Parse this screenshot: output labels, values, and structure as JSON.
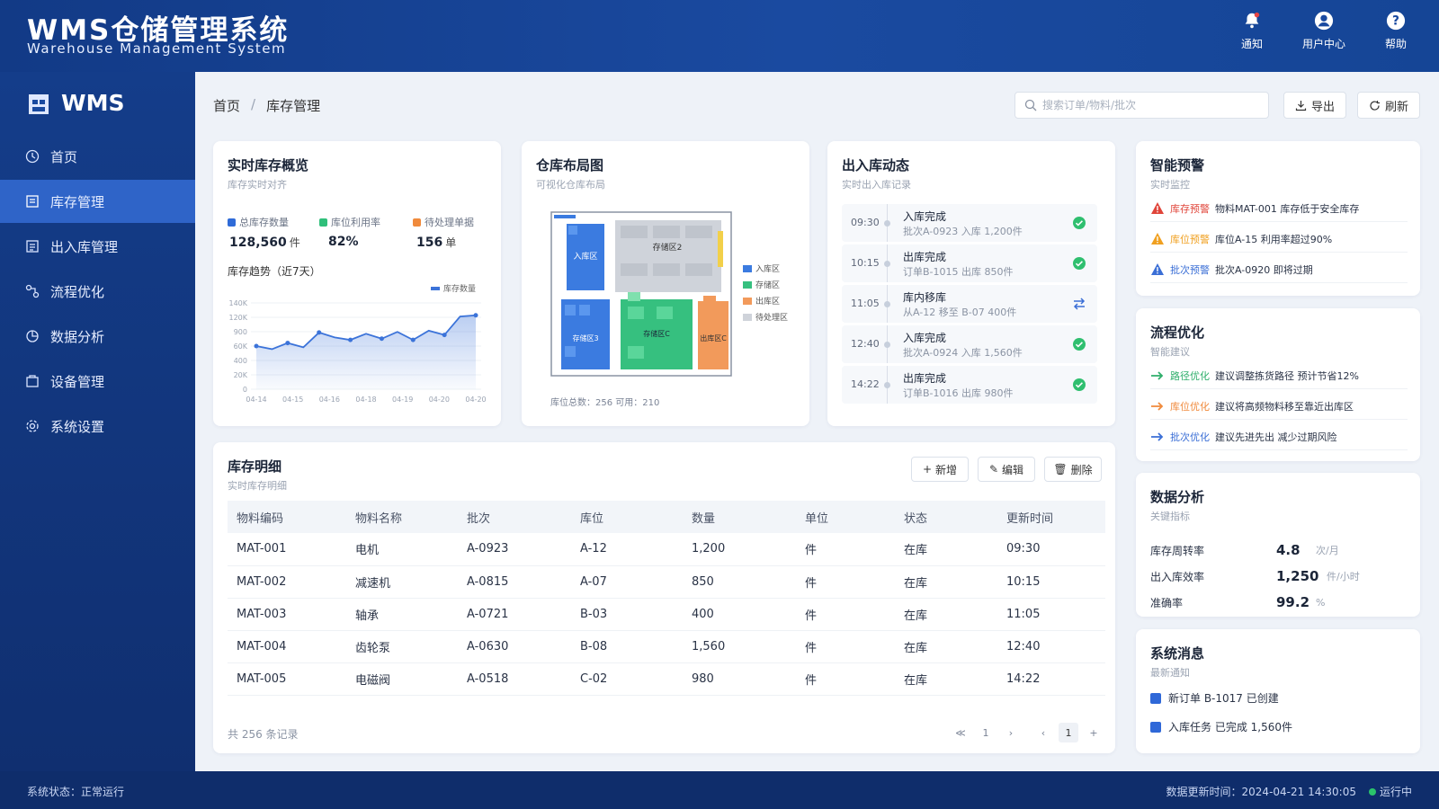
{
  "header": {
    "title": "WMS仓储管理系统",
    "subtitle": "Warehouse Management System",
    "tools": [
      {
        "label": "通知",
        "icon": "bell-icon"
      },
      {
        "label": "用户中心",
        "icon": "user-icon"
      },
      {
        "label": "帮助",
        "icon": "help-icon"
      }
    ]
  },
  "sidebar": {
    "brand": "WMS",
    "items": [
      {
        "label": "首页",
        "icon": "clock-icon"
      },
      {
        "label": "库存管理",
        "icon": "inventory-icon",
        "active": true
      },
      {
        "label": "出入库管理",
        "icon": "inout-icon"
      },
      {
        "label": "流程优化",
        "icon": "flow-icon"
      },
      {
        "label": "数据分析",
        "icon": "chart-icon"
      },
      {
        "label": "设备管理",
        "icon": "device-icon"
      },
      {
        "label": "系统设置",
        "icon": "settings-icon"
      }
    ]
  },
  "breadcrumb": {
    "home": "首页",
    "current": "库存管理"
  },
  "search": {
    "placeholder": "搜索订单/物料/批次"
  },
  "actions": {
    "export": "导出",
    "refresh": "刷新"
  },
  "overview": {
    "title": "实时库存概览",
    "subtitle": "库存实时对齐",
    "stats": [
      {
        "label": "总库存数量",
        "value": "128,560",
        "unit": "件",
        "color": "#2f6bd8"
      },
      {
        "label": "库位利用率",
        "value": "82%",
        "unit": "",
        "color": "#2fbf7a"
      },
      {
        "label": "待处理单据",
        "value": "156",
        "unit": "单",
        "color": "#f08a3c"
      }
    ],
    "trend_title": "库存趋势（近7天）",
    "chart_data": {
      "type": "area",
      "legend": "库存数量",
      "x": [
        "04-14",
        "04-15",
        "04-16",
        "04-18",
        "04-19",
        "04-20",
        "04-20"
      ],
      "y": [
        70000,
        65000,
        75000,
        68000,
        92000,
        84000,
        80000,
        90000,
        82000,
        93000,
        80000,
        95000,
        88000,
        118000,
        120000
      ],
      "yticks": [
        "140K",
        "120K",
        "900",
        "60K",
        "400",
        "20K",
        "0"
      ],
      "ylim": [
        0,
        140000
      ],
      "color": "#3b73d9"
    }
  },
  "layout_map": {
    "title": "仓库布局图",
    "subtitle": "可视化仓库布局",
    "zones": [
      "入库区",
      "存储区2",
      "存储区3",
      "存储区C",
      "出库区C"
    ],
    "legend": [
      {
        "label": "入库区",
        "color": "#3b7be0"
      },
      {
        "label": "存储区",
        "color": "#36c07f"
      },
      {
        "label": "出库区",
        "color": "#f29a5b"
      },
      {
        "label": "待处理区",
        "color": "#cfd3da"
      }
    ],
    "footer": "库位总数：256 可用：210"
  },
  "activity": {
    "title": "出入库动态",
    "subtitle": "实时出入库记录",
    "items": [
      {
        "time": "09:30",
        "title": "入库完成",
        "detail": "批次A-0923 入库 1,200件",
        "status": "done"
      },
      {
        "time": "10:15",
        "title": "出库完成",
        "detail": "订单B-1015 出库 850件",
        "status": "done"
      },
      {
        "time": "11:05",
        "title": "库内移库",
        "detail": "从A-12 移至 B-07 400件",
        "status": "transfer"
      },
      {
        "time": "12:40",
        "title": "入库完成",
        "detail": "批次A-0924 入库 1,560件",
        "status": "done"
      },
      {
        "time": "14:22",
        "title": "出库完成",
        "detail": "订单B-1016 出库 980件",
        "status": "done"
      }
    ]
  },
  "alerts": {
    "title": "智能预警",
    "subtitle": "实时监控",
    "items": [
      {
        "tag": "库存预警",
        "text": "物料MAT-001 库存低于安全库存",
        "color": "#e0453a"
      },
      {
        "tag": "库位预警",
        "text": "库位A-15 利用率超过90%",
        "color": "#f0a020"
      },
      {
        "tag": "批次预警",
        "text": "批次A-0920 即将过期",
        "color": "#3b6fd6"
      }
    ]
  },
  "flow": {
    "title": "流程优化",
    "subtitle": "智能建议",
    "items": [
      {
        "tag": "路径优化",
        "text": "建议调整拣货路径 预计节省12%",
        "color": "#2fae6b"
      },
      {
        "tag": "库位优化",
        "text": "建议将高频物料移至靠近出库区",
        "color": "#f08a3c"
      },
      {
        "tag": "批次优化",
        "text": "建议先进先出 减少过期风险",
        "color": "#3b6fd6"
      }
    ]
  },
  "analytics": {
    "title": "数据分析",
    "subtitle": "关键指标",
    "items": [
      {
        "label": "库存周转率",
        "value": "4.8",
        "unit": "次/月"
      },
      {
        "label": "出入库效率",
        "value": "1,250",
        "unit": "件/小时"
      },
      {
        "label": "准确率",
        "value": "99.2",
        "unit": "%"
      }
    ]
  },
  "messages": {
    "title": "系统消息",
    "subtitle": "最新通知",
    "items": [
      {
        "text": "新订单 B-1017 已创建"
      },
      {
        "text": "入库任务 已完成 1,560件"
      }
    ]
  },
  "detail": {
    "title": "库存明细",
    "subtitle": "实时库存明细",
    "buttons": {
      "add": "新增",
      "edit": "编辑",
      "delete": "删除"
    },
    "columns": [
      "物料编码",
      "物料名称",
      "批次",
      "库位",
      "数量",
      "单位",
      "状态",
      "更新时间"
    ],
    "rows": [
      [
        "MAT-001",
        "电机",
        "A-0923",
        "A-12",
        "1,200",
        "件",
        "在库",
        "09:30"
      ],
      [
        "MAT-002",
        "减速机",
        "A-0815",
        "A-07",
        "850",
        "件",
        "在库",
        "10:15"
      ],
      [
        "MAT-003",
        "轴承",
        "A-0721",
        "B-03",
        "400",
        "件",
        "在库",
        "11:05"
      ],
      [
        "MAT-004",
        "齿轮泵",
        "A-0630",
        "B-08",
        "1,560",
        "件",
        "在库",
        "12:40"
      ],
      [
        "MAT-005",
        "电磁阀",
        "A-0518",
        "C-02",
        "980",
        "件",
        "在库",
        "14:22"
      ]
    ],
    "total": "共 256 条记录",
    "pager": {
      "prev_group": "≪",
      "page1": "1",
      "next": "›",
      "prev": "‹",
      "current": "1",
      "plus": "+"
    }
  },
  "footer": {
    "left": "系统状态：正常运行",
    "right": "数据更新时间：2024-04-21 14:30:05",
    "status": "运行中"
  }
}
